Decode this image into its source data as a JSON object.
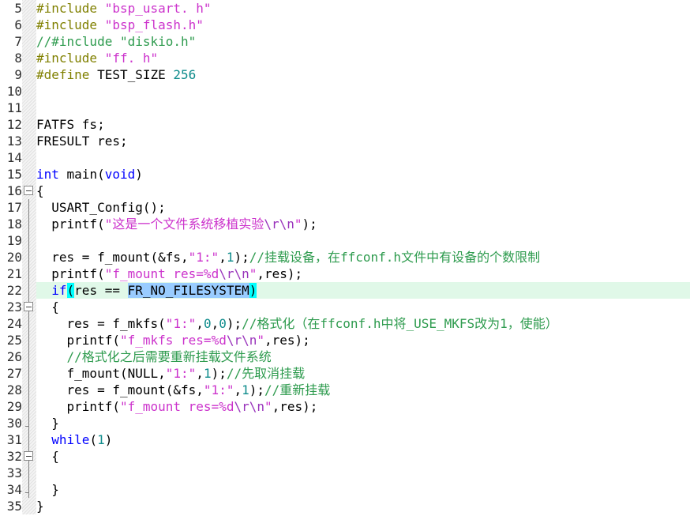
{
  "editor": {
    "first_line": 5,
    "last_line": 35,
    "current_line": 22,
    "language": "C",
    "colors": {
      "background": "#ffffff",
      "preprocessor": "#808000",
      "string": "#cc33cc",
      "escape": "#9933bb",
      "comment": "#2e9b4e",
      "keyword": "#0000ff",
      "number": "#0f8c8c",
      "plain_text": "#000000",
      "line_number": "#2f2f2f",
      "current_line_highlight": "#e0f8e8",
      "selection": "#99ccff",
      "bracket_match": "#00ffff",
      "fold_band": "#eeeeee",
      "fold_line": "#808080"
    }
  },
  "lines": [
    {
      "n": "5",
      "fold": "none",
      "guide": false
    },
    {
      "n": "6",
      "fold": "none",
      "guide": false
    },
    {
      "n": "7",
      "fold": "none",
      "guide": false
    },
    {
      "n": "8",
      "fold": "none",
      "guide": false
    },
    {
      "n": "9",
      "fold": "none",
      "guide": false
    },
    {
      "n": "10",
      "fold": "none",
      "guide": false
    },
    {
      "n": "11",
      "fold": "none",
      "guide": false
    },
    {
      "n": "12",
      "fold": "none",
      "guide": false
    },
    {
      "n": "13",
      "fold": "none",
      "guide": false
    },
    {
      "n": "14",
      "fold": "none",
      "guide": false
    },
    {
      "n": "15",
      "fold": "none",
      "guide": false
    },
    {
      "n": "16",
      "fold": "open",
      "guide": false
    },
    {
      "n": "17",
      "fold": "none",
      "guide": true
    },
    {
      "n": "18",
      "fold": "none",
      "guide": true
    },
    {
      "n": "19",
      "fold": "none",
      "guide": true
    },
    {
      "n": "20",
      "fold": "none",
      "guide": true
    },
    {
      "n": "21",
      "fold": "none",
      "guide": true
    },
    {
      "n": "22",
      "fold": "none",
      "guide": true
    },
    {
      "n": "23",
      "fold": "open",
      "guide": true
    },
    {
      "n": "24",
      "fold": "none",
      "guide": true
    },
    {
      "n": "25",
      "fold": "none",
      "guide": true
    },
    {
      "n": "26",
      "fold": "none",
      "guide": true
    },
    {
      "n": "27",
      "fold": "none",
      "guide": true
    },
    {
      "n": "28",
      "fold": "none",
      "guide": true
    },
    {
      "n": "29",
      "fold": "none",
      "guide": true
    },
    {
      "n": "30",
      "fold": "end",
      "guide": true
    },
    {
      "n": "31",
      "fold": "none",
      "guide": true
    },
    {
      "n": "32",
      "fold": "open",
      "guide": true
    },
    {
      "n": "33",
      "fold": "none",
      "guide": true
    },
    {
      "n": "34",
      "fold": "end",
      "guide": true
    },
    {
      "n": "35",
      "fold": "none",
      "guide": false
    }
  ],
  "code": {
    "l5": [
      {
        "t": "pre",
        "s": "#include "
      },
      {
        "t": "str",
        "s": "\"bsp_usart. h\""
      }
    ],
    "l6": [
      {
        "t": "pre",
        "s": "#include "
      },
      {
        "t": "str",
        "s": "\"bsp_flash.h\""
      }
    ],
    "l7": [
      {
        "t": "cmt",
        "s": "//#include \"diskio.h\""
      }
    ],
    "l8": [
      {
        "t": "pre",
        "s": "#include "
      },
      {
        "t": "str",
        "s": "\"ff. h\""
      }
    ],
    "l9": [
      {
        "t": "pre",
        "s": "#define "
      },
      {
        "t": "plain",
        "s": "TEST_SIZE "
      },
      {
        "t": "num",
        "s": "256"
      }
    ],
    "l10": [],
    "l11": [],
    "l12": [
      {
        "t": "plain",
        "s": "FATFS fs;"
      }
    ],
    "l13": [
      {
        "t": "plain",
        "s": "FRESULT res;"
      }
    ],
    "l14": [],
    "l15": [
      {
        "t": "kw",
        "s": "int"
      },
      {
        "t": "plain",
        "s": " main("
      },
      {
        "t": "kw",
        "s": "void"
      },
      {
        "t": "plain",
        "s": ")"
      }
    ],
    "l16": [
      {
        "t": "plain",
        "s": "{"
      }
    ],
    "l17": [
      {
        "t": "plain",
        "s": "  USART_Config();"
      }
    ],
    "l18": [
      {
        "t": "plain",
        "s": "  printf("
      },
      {
        "t": "str",
        "s": "\"这是一个文件系统移植实验"
      },
      {
        "t": "esc",
        "s": "\\r\\n"
      },
      {
        "t": "str",
        "s": "\""
      },
      {
        "t": "plain",
        "s": ");"
      }
    ],
    "l19": [],
    "l20": [
      {
        "t": "plain",
        "s": "  res = f_mount(&fs,"
      },
      {
        "t": "str",
        "s": "\"1:\""
      },
      {
        "t": "plain",
        "s": ","
      },
      {
        "t": "num",
        "s": "1"
      },
      {
        "t": "plain",
        "s": ");"
      },
      {
        "t": "cmt",
        "s": "//挂载设备，在ffconf.h文件中有设备的个数限制"
      }
    ],
    "l21": [
      {
        "t": "plain",
        "s": "  printf("
      },
      {
        "t": "str",
        "s": "\"f_mount res=%d"
      },
      {
        "t": "esc",
        "s": "\\r\\n"
      },
      {
        "t": "str",
        "s": "\""
      },
      {
        "t": "plain",
        "s": ",res);"
      }
    ],
    "l22": [
      {
        "t": "plain",
        "s": "  "
      },
      {
        "t": "kw",
        "s": "if"
      },
      {
        "t": "brk",
        "s": "("
      },
      {
        "t": "plain",
        "s": "res == "
      },
      {
        "t": "sel",
        "s": "FR_NO_FILESYSTEM"
      },
      {
        "t": "caret",
        "s": ""
      },
      {
        "t": "brk",
        "s": ")"
      }
    ],
    "l23": [
      {
        "t": "plain",
        "s": "  {"
      }
    ],
    "l24": [
      {
        "t": "plain",
        "s": "    res = f_mkfs("
      },
      {
        "t": "str",
        "s": "\"1:\""
      },
      {
        "t": "plain",
        "s": ","
      },
      {
        "t": "num",
        "s": "0"
      },
      {
        "t": "plain",
        "s": ","
      },
      {
        "t": "num",
        "s": "0"
      },
      {
        "t": "plain",
        "s": ");"
      },
      {
        "t": "cmt",
        "s": "//格式化（在ffconf.h中将_USE_MKFS改为1，使能）"
      }
    ],
    "l25": [
      {
        "t": "plain",
        "s": "    printf("
      },
      {
        "t": "str",
        "s": "\"f_mkfs res=%d"
      },
      {
        "t": "esc",
        "s": "\\r\\n"
      },
      {
        "t": "str",
        "s": "\""
      },
      {
        "t": "plain",
        "s": ",res);"
      }
    ],
    "l26": [
      {
        "t": "cmt",
        "s": "    //格式化之后需要重新挂载文件系统"
      }
    ],
    "l27": [
      {
        "t": "plain",
        "s": "    f_mount(NULL,"
      },
      {
        "t": "str",
        "s": "\"1:\""
      },
      {
        "t": "plain",
        "s": ","
      },
      {
        "t": "num",
        "s": "1"
      },
      {
        "t": "plain",
        "s": ");"
      },
      {
        "t": "cmt",
        "s": "//先取消挂载"
      }
    ],
    "l28": [
      {
        "t": "plain",
        "s": "    res = f_mount(&fs,"
      },
      {
        "t": "str",
        "s": "\"1:\""
      },
      {
        "t": "plain",
        "s": ","
      },
      {
        "t": "num",
        "s": "1"
      },
      {
        "t": "plain",
        "s": ");"
      },
      {
        "t": "cmt",
        "s": "//重新挂载"
      }
    ],
    "l29": [
      {
        "t": "plain",
        "s": "    printf("
      },
      {
        "t": "str",
        "s": "\"f_mount res=%d"
      },
      {
        "t": "esc",
        "s": "\\r\\n"
      },
      {
        "t": "str",
        "s": "\""
      },
      {
        "t": "plain",
        "s": ",res);"
      }
    ],
    "l30": [
      {
        "t": "plain",
        "s": "  }"
      }
    ],
    "l31": [
      {
        "t": "plain",
        "s": "  "
      },
      {
        "t": "kw",
        "s": "while"
      },
      {
        "t": "plain",
        "s": "("
      },
      {
        "t": "num",
        "s": "1"
      },
      {
        "t": "plain",
        "s": ")"
      }
    ],
    "l32": [
      {
        "t": "plain",
        "s": "  {"
      }
    ],
    "l33": [],
    "l34": [
      {
        "t": "plain",
        "s": "  }"
      }
    ],
    "l35": [
      {
        "t": "plain",
        "s": "}"
      }
    ]
  }
}
